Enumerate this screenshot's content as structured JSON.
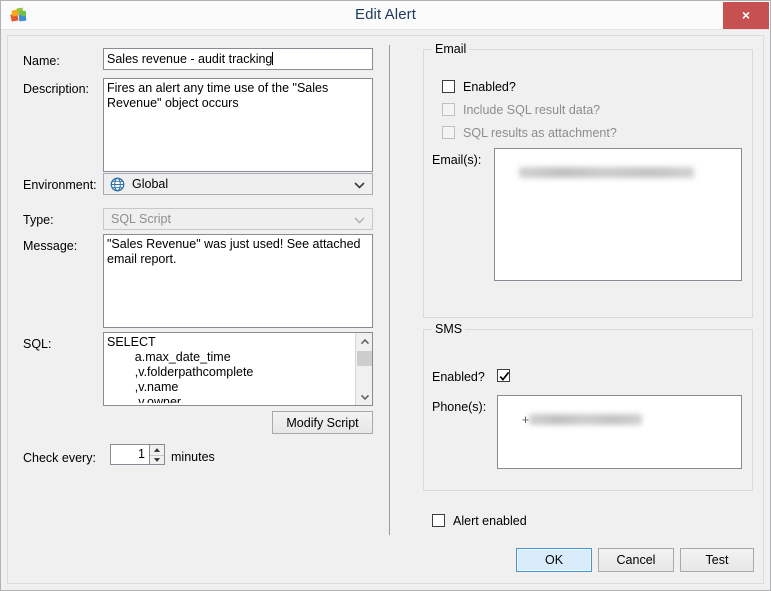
{
  "window": {
    "title": "Edit Alert",
    "icon": "app-blocks-icon",
    "close_label": "×",
    "close_color": "#c75050"
  },
  "left_panel": {
    "name": {
      "label": "Name:",
      "value": "Sales revenue - audit tracking"
    },
    "description": {
      "label": "Description:",
      "value": "Fires an alert any time use of the \"Sales Revenue\" object occurs"
    },
    "environment": {
      "label": "Environment:",
      "value": "Global",
      "icon": "globe-icon",
      "enabled": true
    },
    "type": {
      "label": "Type:",
      "value": "SQL Script",
      "enabled": false
    },
    "message": {
      "label": "Message:",
      "value": "\"Sales Revenue\" was just used! See attached email report."
    },
    "sql": {
      "label": "SQL:",
      "value": "SELECT\n        a.max_date_time\n        ,v.folderpathcomplete\n        ,v.name\n        ,v.owner"
    },
    "modify_script_button": "Modify Script",
    "check_every": {
      "label": "Check every:",
      "value": "1",
      "units": "minutes"
    }
  },
  "right_panel": {
    "email_group": {
      "title": "Email",
      "enabled_label": "Enabled?",
      "enabled_checked": false,
      "include_sql_label": "Include SQL result data?",
      "include_sql_checked": false,
      "include_sql_disabled": true,
      "attachment_label": "SQL results as attachment?",
      "attachment_checked": false,
      "attachment_disabled": true,
      "emails_label": "Email(s):",
      "emails_value": "████████████████████████",
      "emails_redacted": true
    },
    "sms_group": {
      "title": "SMS",
      "enabled_label": "Enabled?",
      "enabled_checked": true,
      "phones_label": "Phone(s):",
      "phones_prefix": "+",
      "phones_value": "██████████████",
      "phones_redacted": true
    },
    "alert_enabled": {
      "label": "Alert enabled",
      "checked": false
    },
    "buttons": {
      "ok": "OK",
      "cancel": "Cancel",
      "test": "Test",
      "default": "ok"
    }
  }
}
